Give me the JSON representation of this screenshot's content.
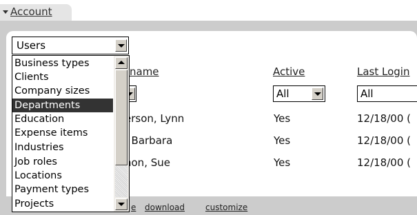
{
  "section_tab": {
    "label": "Account"
  },
  "users_select": {
    "value": "Users"
  },
  "table": {
    "headers": {
      "name": "name",
      "active": "Active",
      "last_login": "Last Login"
    },
    "filters": {
      "active": "All",
      "last_login": "All"
    },
    "rows": [
      {
        "name": "erson, Lynn",
        "active": "Yes",
        "last_login": "12/18/00 ("
      },
      {
        "name": ", Barbara",
        "active": "Yes",
        "last_login": "12/18/00 ("
      },
      {
        "name": "non, Sue",
        "active": "Yes",
        "last_login": "12/18/00 ("
      }
    ]
  },
  "dropdown": {
    "options": [
      "Business types",
      "Clients",
      "Company sizes",
      "Departments",
      "Education",
      "Expense items",
      "Industries",
      "Job roles",
      "Locations",
      "Payment types",
      "Projects"
    ],
    "selected": "Departments"
  },
  "footer": {
    "download": "download",
    "customize": "customize",
    "partial_text": "e"
  }
}
